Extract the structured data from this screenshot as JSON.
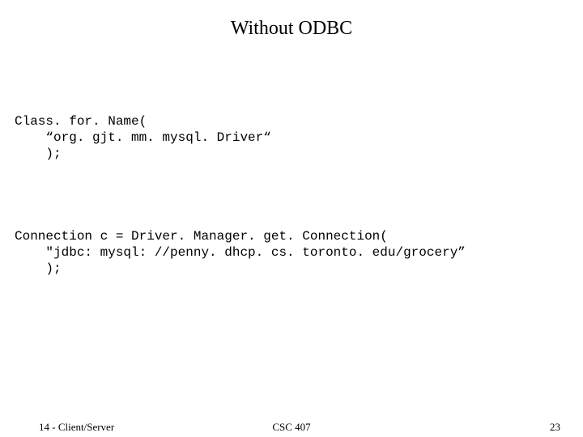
{
  "title": "Without ODBC",
  "code1": {
    "l1": "Class. for. Name(",
    "l2": "    “org. gjt. mm. mysql. Driver“",
    "l3": "    );"
  },
  "code2": {
    "l1": "Connection c = Driver. Manager. get. Connection(",
    "l2": "    \"jdbc: mysql: //penny. dhcp. cs. toronto. edu/grocery”",
    "l3": "    );"
  },
  "footer": {
    "left": "14 - Client/Server",
    "center": "CSC 407",
    "right": "23"
  }
}
